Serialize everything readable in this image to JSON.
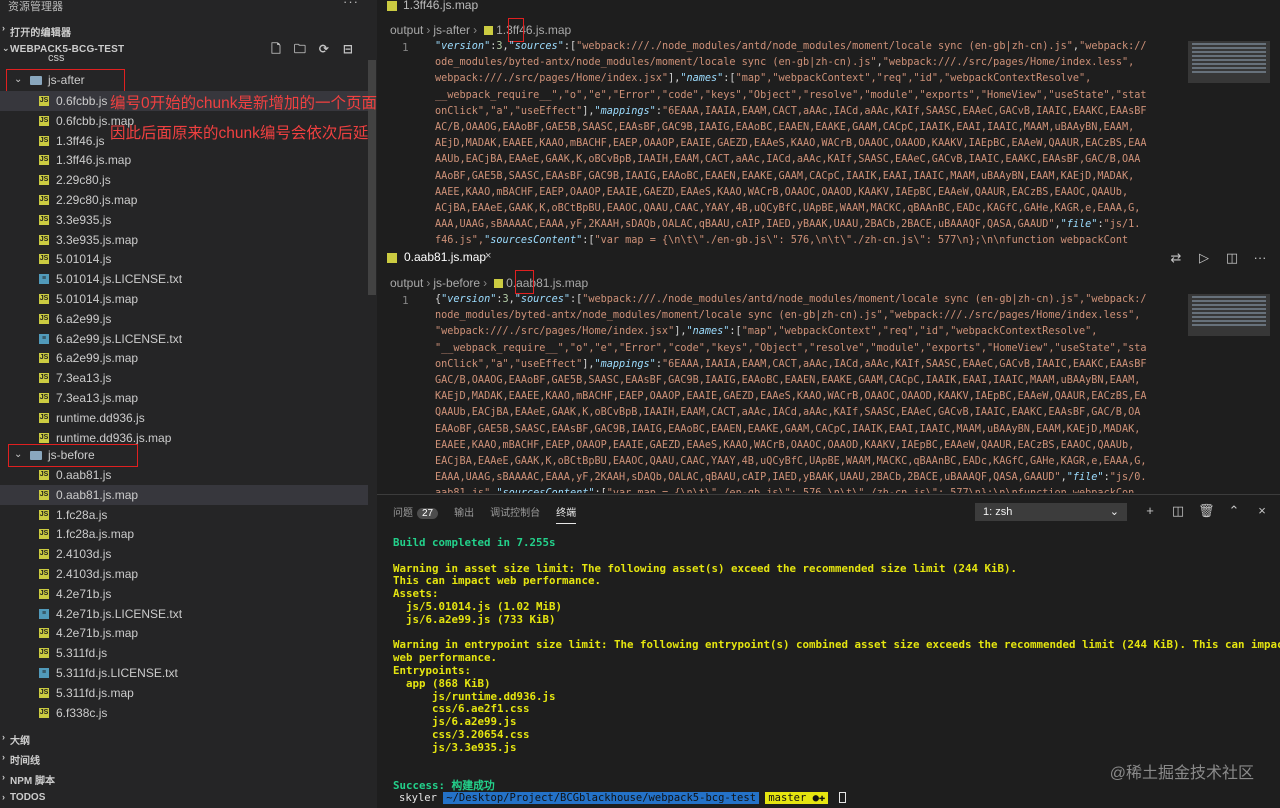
{
  "sidebar": {
    "title": "资源管理器",
    "open_editors": "打开的编辑器",
    "workspace": "WEBPACK5-BCG-TEST",
    "css_folder": "css",
    "js_after_folder": "js-after",
    "js_before_folder": "js-before",
    "js_after_files": [
      {
        "name": "0.6fcbb.js",
        "type": "js"
      },
      {
        "name": "0.6fcbb.js.map",
        "type": "js"
      },
      {
        "name": "1.3ff46.js",
        "type": "js"
      },
      {
        "name": "1.3ff46.js.map",
        "type": "js"
      },
      {
        "name": "2.29c80.js",
        "type": "js"
      },
      {
        "name": "2.29c80.js.map",
        "type": "js"
      },
      {
        "name": "3.3e935.js",
        "type": "js"
      },
      {
        "name": "3.3e935.js.map",
        "type": "js"
      },
      {
        "name": "5.01014.js",
        "type": "js"
      },
      {
        "name": "5.01014.js.LICENSE.txt",
        "type": "txt"
      },
      {
        "name": "5.01014.js.map",
        "type": "js"
      },
      {
        "name": "6.a2e99.js",
        "type": "js"
      },
      {
        "name": "6.a2e99.js.LICENSE.txt",
        "type": "txt"
      },
      {
        "name": "6.a2e99.js.map",
        "type": "js"
      },
      {
        "name": "7.3ea13.js",
        "type": "js"
      },
      {
        "name": "7.3ea13.js.map",
        "type": "js"
      },
      {
        "name": "runtime.dd936.js",
        "type": "js"
      },
      {
        "name": "runtime.dd936.js.map",
        "type": "js"
      }
    ],
    "js_before_files": [
      {
        "name": "0.aab81.js",
        "type": "js"
      },
      {
        "name": "0.aab81.js.map",
        "type": "js"
      },
      {
        "name": "1.fc28a.js",
        "type": "js"
      },
      {
        "name": "1.fc28a.js.map",
        "type": "js"
      },
      {
        "name": "2.4103d.js",
        "type": "js"
      },
      {
        "name": "2.4103d.js.map",
        "type": "js"
      },
      {
        "name": "4.2e71b.js",
        "type": "js"
      },
      {
        "name": "4.2e71b.js.LICENSE.txt",
        "type": "txt"
      },
      {
        "name": "4.2e71b.js.map",
        "type": "js"
      },
      {
        "name": "5.311fd.js",
        "type": "js"
      },
      {
        "name": "5.311fd.js.LICENSE.txt",
        "type": "txt"
      },
      {
        "name": "5.311fd.js.map",
        "type": "js"
      },
      {
        "name": "6.f338c.js",
        "type": "js"
      }
    ],
    "bottom_sections": [
      "大纲",
      "时间线",
      "NPM 脚本",
      "TODOS"
    ]
  },
  "annotation": {
    "line1": "编号0开始的chunk是新增加的一个页面，",
    "line2": "因此后面原来的chunk编号会依次后延"
  },
  "editor_top": {
    "tab": "1.3ff46.js.map",
    "breadcrumb": [
      "output",
      "js-after",
      "1.3ff46.js.map"
    ],
    "line_number": "1"
  },
  "editor_bottom": {
    "tab": "0.aab81.js.map",
    "breadcrumb": [
      "output",
      "js-before",
      "0.aab81.js.map"
    ],
    "line_number": "1"
  },
  "panel": {
    "tabs": [
      "问题",
      "输出",
      "调试控制台",
      "终端"
    ],
    "problems_count": "27",
    "active_tab": "终端",
    "terminal_select": "1: zsh",
    "terminal_lines": [
      {
        "t": "Build completed in 7.255s",
        "c": "g"
      },
      {
        "t": "",
        "c": "g"
      },
      {
        "t": "Warning in asset size limit: The following asset(s) exceed the recommended size limit (244 KiB).",
        "c": "y"
      },
      {
        "t": "This can impact web performance.",
        "c": "y"
      },
      {
        "t": "Assets:",
        "c": "y"
      },
      {
        "t": "  js/5.01014.js (1.02 MiB)",
        "c": "y"
      },
      {
        "t": "  js/6.a2e99.js (733 KiB)",
        "c": "y"
      },
      {
        "t": "",
        "c": "y"
      },
      {
        "t": "Warning in entrypoint size limit: The following entrypoint(s) combined asset size exceeds the recommended limit (244 KiB). This can impact",
        "c": "y"
      },
      {
        "t": "web performance.",
        "c": "y"
      },
      {
        "t": "Entrypoints:",
        "c": "y"
      },
      {
        "t": "  app (868 KiB)",
        "c": "y"
      },
      {
        "t": "      js/runtime.dd936.js",
        "c": "y"
      },
      {
        "t": "      css/6.ae2f1.css",
        "c": "y"
      },
      {
        "t": "      js/6.a2e99.js",
        "c": "y"
      },
      {
        "t": "      css/3.20654.css",
        "c": "y"
      },
      {
        "t": "      js/3.3e935.js",
        "c": "y"
      },
      {
        "t": "",
        "c": "y"
      },
      {
        "t": "",
        "c": "y"
      },
      {
        "t": "Success: 构建成功",
        "c": "g"
      }
    ],
    "prompt_user": "skyler",
    "prompt_path": "~/Desktop/Project/BCGblackhouse/webpack5-bcg-test",
    "prompt_branch": "master ●✚"
  },
  "watermark": "@稀土掘金技术社区"
}
